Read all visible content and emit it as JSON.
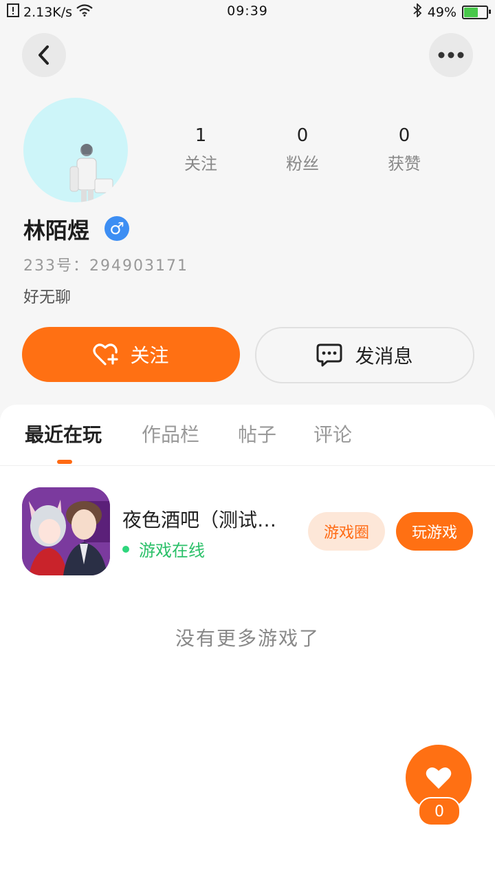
{
  "status_bar": {
    "net_speed": "2.13K/s",
    "time": "09:39",
    "battery": "49%"
  },
  "profile": {
    "name": "林陌煜",
    "gender_symbol": "♂",
    "uid": "233号：294903171",
    "bio": "好无聊",
    "stats": [
      {
        "value": "1",
        "label": "关注"
      },
      {
        "value": "0",
        "label": "粉丝"
      },
      {
        "value": "0",
        "label": "获赞"
      }
    ]
  },
  "actions": {
    "follow": "关注",
    "message": "发消息"
  },
  "tabs": [
    "最近在玩",
    "作品栏",
    "帖子",
    "评论"
  ],
  "game": {
    "title": "夜色酒吧（测试…",
    "status": "游戏在线",
    "circle_label": "游戏圈",
    "play_label": "玩游戏"
  },
  "no_more": "没有更多游戏了",
  "fab": {
    "count": "0"
  },
  "colors": {
    "accent": "#ff7013",
    "online": "#2fd67d",
    "gender": "#3d8ef3"
  }
}
